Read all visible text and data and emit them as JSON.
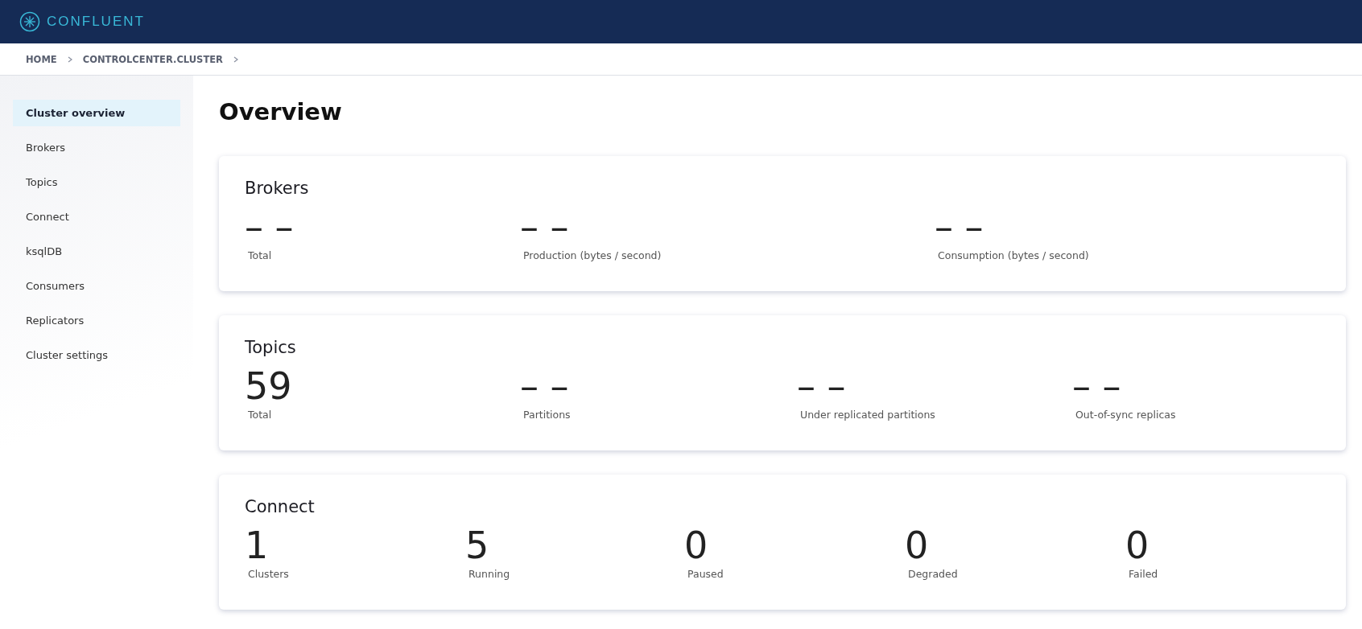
{
  "header": {
    "brand": "CONFLUENT"
  },
  "breadcrumb": [
    "HOME",
    "CONTROLCENTER.CLUSTER"
  ],
  "sidebar": {
    "items": [
      {
        "label": "Cluster overview",
        "selected": true
      },
      {
        "label": "Brokers",
        "selected": false
      },
      {
        "label": "Topics",
        "selected": false
      },
      {
        "label": "Connect",
        "selected": false
      },
      {
        "label": "ksqlDB",
        "selected": false
      },
      {
        "label": "Consumers",
        "selected": false
      },
      {
        "label": "Replicators",
        "selected": false
      },
      {
        "label": "Cluster settings",
        "selected": false
      }
    ]
  },
  "page_title": "Overview",
  "cards": [
    {
      "kind": "brokers",
      "title": "Brokers",
      "metrics": [
        {
          "value": "– –",
          "label": "Total"
        },
        {
          "value": "– –",
          "label": "Production (bytes / second)"
        },
        {
          "value": "– –",
          "label": "Consumption (bytes / second)"
        }
      ]
    },
    {
      "kind": "topics",
      "title": "Topics",
      "metrics": [
        {
          "value": "59",
          "label": "Total"
        },
        {
          "value": "– –",
          "label": "Partitions"
        },
        {
          "value": "– –",
          "label": "Under replicated partitions"
        },
        {
          "value": "– –",
          "label": "Out-of-sync replicas"
        }
      ]
    },
    {
      "kind": "connect",
      "title": "Connect",
      "metrics": [
        {
          "value": "1",
          "label": "Clusters"
        },
        {
          "value": "5",
          "label": "Running"
        },
        {
          "value": "0",
          "label": "Paused"
        },
        {
          "value": "0",
          "label": "Degraded"
        },
        {
          "value": "0",
          "label": "Failed"
        }
      ]
    }
  ]
}
